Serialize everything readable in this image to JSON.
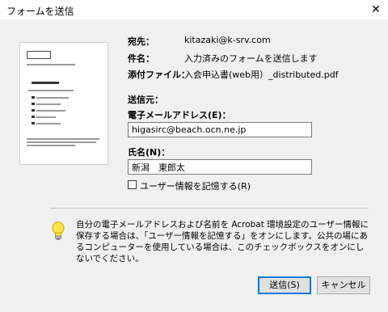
{
  "window": {
    "title": "フォームを送信",
    "close_glyph": "✕"
  },
  "summary": {
    "to_label": "宛先：",
    "to_value": "kitazaki@k-srv.com",
    "subject_label": "件名：",
    "subject_value": "入力済みのフォームを送信します",
    "attach_label": "添付ファイル：",
    "attach_value": "入会申込書(web用）_distributed.pdf"
  },
  "sender": {
    "section_label": "送信元：",
    "email_label": "電子メールアドレス(E)：",
    "email_value": "higasirc@beach.ocn.ne.jp",
    "name_label": "氏名(N)：",
    "name_value": "新潟　東郎太",
    "remember_label": "ユーザー情報を記憶する(R)",
    "remember_checked": false
  },
  "info": {
    "icon": "lightbulb-icon",
    "text": "自分の電子メールアドレスおよび名前を Acrobat 環境設定のユーザー情報に保存する場合は、「ユーザー情報を記憶する」をオンにします。公共の場にあるコンピューターを使用している場合は、このチェックボックスをオンにしないでください。"
  },
  "buttons": {
    "send": "送信(S)",
    "cancel": "キャンセル"
  },
  "colors": {
    "accent": "#0078d7",
    "background": "#f0f0f0"
  }
}
